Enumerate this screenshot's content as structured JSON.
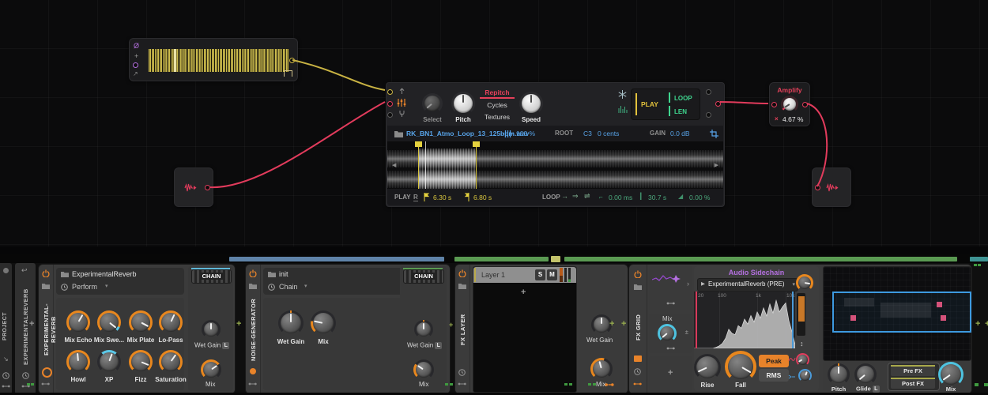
{
  "grid": {
    "sampler": {
      "select": "Select",
      "pitch": "Pitch",
      "speed": "Speed",
      "modes": [
        "Repitch",
        "Cycles",
        "Textures"
      ],
      "play": "PLAY",
      "loop": "LOOP",
      "len": "LEN",
      "file": "RK_BN1_Atmo_Loop_13_125bpm.wav",
      "stretch": "100 %",
      "root_label": "ROOT",
      "root": "C3",
      "tune": "0 cents",
      "gain_label": "GAIN",
      "gain": "0.0 dB",
      "footer": {
        "play": "PLAY",
        "reverse": "R",
        "start": "6.30 s",
        "end": "6.80 s",
        "loop": "LOOP",
        "offset": "0.00 ms",
        "length": "30.7 s",
        "crossfade": "0.00 %"
      }
    },
    "amplify": {
      "title": "Amplify",
      "value": "4.67 %"
    }
  },
  "rails": {
    "project": "PROJECT",
    "parent": "EXPERIMENTALREVERB"
  },
  "reverb": {
    "title": "EXPERIMENTAL-REVERB",
    "preset": "ExperimentalReverb",
    "mode": "Perform",
    "k1": "Mix Echo",
    "k2": "Mix Swe...",
    "k3": "Mix Plate",
    "k4": "Lo-Pass",
    "k5": "Howl",
    "k6": "XP",
    "k7": "Fizz",
    "k8": "Saturation",
    "chain": "CHAIN",
    "wet_gain": "Wet Gain",
    "mix": "Mix",
    "latch": "L"
  },
  "noise": {
    "title": "NOISE-GENERATOR",
    "preset": "init",
    "mode": "Chain",
    "wet_gain": "Wet Gain",
    "mix": "Mix",
    "chain": "CHAIN",
    "latch": "L"
  },
  "fxlayer": {
    "title": "FX LAYER",
    "layer": "Layer 1",
    "solo": "S",
    "mute": "M",
    "wet_gain": "Wet Gain",
    "mix": "Mix"
  },
  "fxgrid": {
    "title": "FX GRID",
    "mix_small": "Mix",
    "plusminus": "±",
    "module_title": "Audio Sidechain",
    "source": "ExperimentalReverb (PRE)",
    "freq_ticks": [
      "20",
      "100",
      "1k",
      "10k"
    ],
    "rise": "Rise",
    "fall": "Fall",
    "peak": "Peak",
    "rms": "RMS",
    "pitch": "Pitch",
    "glide": "Glide",
    "latch": "L",
    "pre_fx": "Pre FX",
    "post_fx": "Post FX",
    "mix": "Mix",
    "spectrum": [
      0,
      0,
      0,
      0,
      0,
      0,
      0,
      0.02,
      0.05,
      0.1,
      0.2,
      0.38,
      0.3,
      0.27,
      0.45,
      0.4,
      0.58,
      0.48,
      0.65,
      0.52,
      0.72,
      0.6,
      0.8,
      0.64,
      0.88,
      0.7,
      0.95,
      0.72,
      0.82,
      0.9,
      0.55,
      0.33,
      0.08
    ]
  },
  "ui": {
    "plus": "+",
    "caret": "▾",
    "chev": "›"
  }
}
